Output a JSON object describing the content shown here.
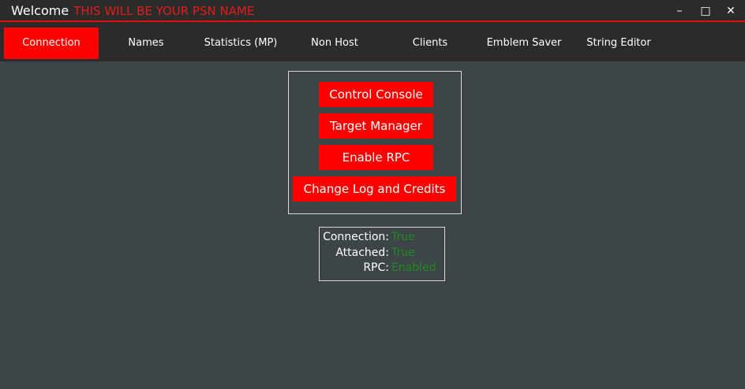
{
  "window": {
    "title": "Welcome",
    "psn_name": "THIS WILL BE YOUR PSN NAME",
    "minimize_glyph": "–",
    "maximize_glyph": "□",
    "close_glyph": "✕"
  },
  "tabs": [
    {
      "label": "Connection",
      "active": true
    },
    {
      "label": "Names"
    },
    {
      "label": "Statistics (MP)"
    },
    {
      "label": "Non Host"
    },
    {
      "label": "Clients"
    },
    {
      "label": "Emblem Saver"
    },
    {
      "label": "String Editor"
    }
  ],
  "buttons": {
    "control_console": "Control Console",
    "target_manager": "Target Manager",
    "enable_rpc": "Enable RPC",
    "change_log": "Change Log and Credits"
  },
  "status": {
    "connection_label": "Connection:",
    "connection_value": "True",
    "attached_label": "Attached:",
    "attached_value": "True",
    "rpc_label": "RPC:",
    "rpc_value": "Enabled"
  },
  "colors": {
    "accent": "#ff0000",
    "titlebar": "#2b2b2b",
    "background": "#3d4548",
    "status_value": "#1f8a1f"
  }
}
